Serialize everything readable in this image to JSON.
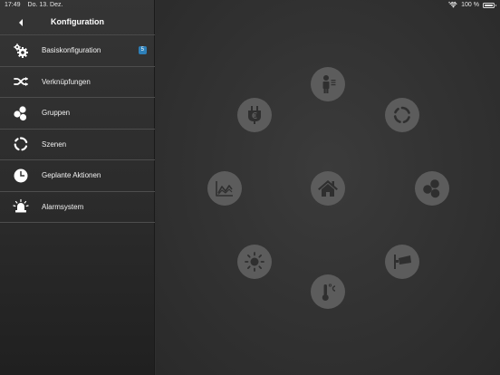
{
  "status": {
    "time": "17:49",
    "date": "Do. 13. Dez.",
    "dots": "•••",
    "battery": "100 %"
  },
  "nav": {
    "title": "Konfiguration"
  },
  "menu": {
    "items": [
      {
        "label": "Basiskonfiguration",
        "icon": "gears-icon",
        "badge": "5"
      },
      {
        "label": "Verknüpfungen",
        "icon": "links-icon"
      },
      {
        "label": "Gruppen",
        "icon": "groups-icon"
      },
      {
        "label": "Szenen",
        "icon": "scenes-icon"
      },
      {
        "label": "Geplante Aktionen",
        "icon": "clock-icon"
      },
      {
        "label": "Alarmsystem",
        "icon": "alarm-icon"
      }
    ]
  },
  "hub_icons": [
    "person-icon",
    "cycle-icon",
    "groups-icon",
    "camera-icon",
    "thermometer-icon",
    "sun-icon",
    "chart-icon",
    "energy-plug-icon",
    "home-icon"
  ],
  "colors": {
    "badge": "#2d7fb8",
    "hub": "#5c5c5c",
    "icon": "#2f2f2f"
  }
}
